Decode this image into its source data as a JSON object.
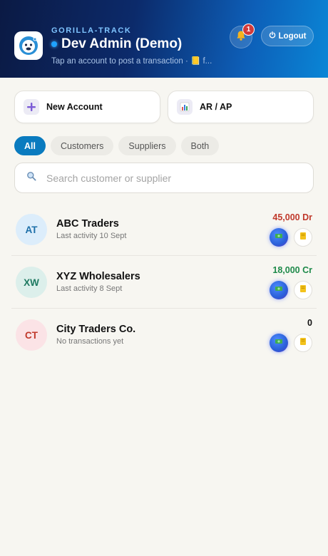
{
  "header": {
    "brand": "GORILLA-TRACK",
    "title": "Dev Admin (Demo)",
    "subtitle": "Tap an account to post a transaction · 📒 f...",
    "notification_count": "1",
    "logout_label": "Logout"
  },
  "actions": {
    "new_account_label": "New Account",
    "arap_label": "AR / AP"
  },
  "filters": [
    "All",
    "Customers",
    "Suppliers",
    "Both"
  ],
  "active_filter": "All",
  "search": {
    "placeholder": "Search customer or supplier",
    "value": ""
  },
  "accounts": [
    {
      "initials": "AT",
      "name": "ABC Traders",
      "meta": "Last activity 10 Sept",
      "amount": "45,000 Dr",
      "amount_color": "#c0392b",
      "avatar_bg": "#dcedfb",
      "avatar_fg": "#1d6fa8"
    },
    {
      "initials": "XW",
      "name": "XYZ Wholesalers",
      "meta": "Last activity 8 Sept",
      "amount": "18,000 Cr",
      "amount_color": "#1e8a4a",
      "avatar_bg": "#dcefeb",
      "avatar_fg": "#1f7a62"
    },
    {
      "initials": "CT",
      "name": "City Traders Co.",
      "meta": "No transactions yet",
      "amount": "0",
      "amount_color": "#111111",
      "avatar_bg": "#fbe3e6",
      "avatar_fg": "#c0392b"
    }
  ],
  "icons": {
    "bell": "bell-icon",
    "power": "power-icon",
    "plus": "plus-icon",
    "chart": "bar-chart-icon",
    "search": "search-icon",
    "cash": "cash-icon",
    "ledger": "ledger-icon"
  }
}
